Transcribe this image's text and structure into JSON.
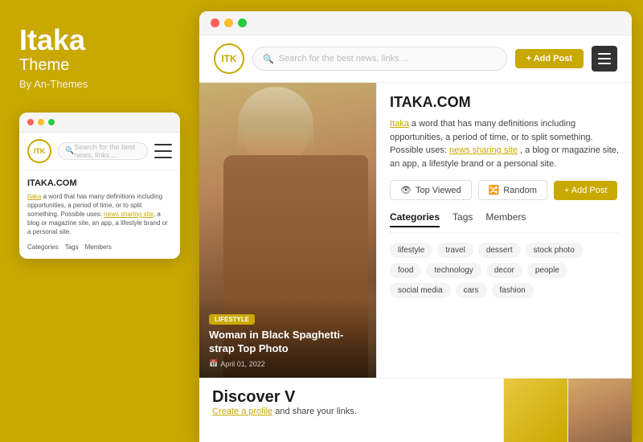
{
  "left": {
    "brand_title": "Itaka",
    "brand_subtitle": "Theme",
    "brand_by": "By An-Themes",
    "mini_logo": "ITK",
    "mini_search_placeholder": "Search for the best news, links ...",
    "mini_site_title": "ITAKA.COM",
    "mini_description": "Itaka a word that has many definitions including opportunities, a period of time, or to split something. Possible uses: news sharing site, a blog or magazine site, an app, a lifestyle brand or a personal site.",
    "mini_link_text": "news sharing site",
    "mini_cats": [
      "Categories",
      "Tags",
      "Members"
    ]
  },
  "browser": {
    "logo": "ITK",
    "search_placeholder": "Search for the best news, links ...",
    "add_post_label": "+ Add Post",
    "featured": {
      "category": "LIFESTYLE",
      "title": "Woman in Black Spaghetti-strap Top Photo",
      "date": "April 01, 2022",
      "date_icon": "📅"
    },
    "sidebar": {
      "site_title": "ITAKA.COM",
      "description_prefix": "Itaka",
      "description_text": " a word that has many definitions including opportunities, a period of time, or to split something. Possible uses: ",
      "link_text": "news sharing site",
      "description_suffix": ", a blog or magazine site, an app, a lifestyle brand or a personal site.",
      "btn_top_viewed": "Top Viewed",
      "btn_random": "Random",
      "btn_add_post": "+ Add Post",
      "tabs": [
        "Categories",
        "Tags",
        "Members"
      ],
      "active_tab": "Categories",
      "tags": [
        "lifestyle",
        "travel",
        "dessert",
        "stock photo",
        "food",
        "technology",
        "decor",
        "people",
        "social media",
        "cars",
        "fashion"
      ]
    },
    "bottom": {
      "discover_title": "Discover V",
      "discover_cta": "Create a profile",
      "discover_suffix": " and share your links."
    }
  }
}
